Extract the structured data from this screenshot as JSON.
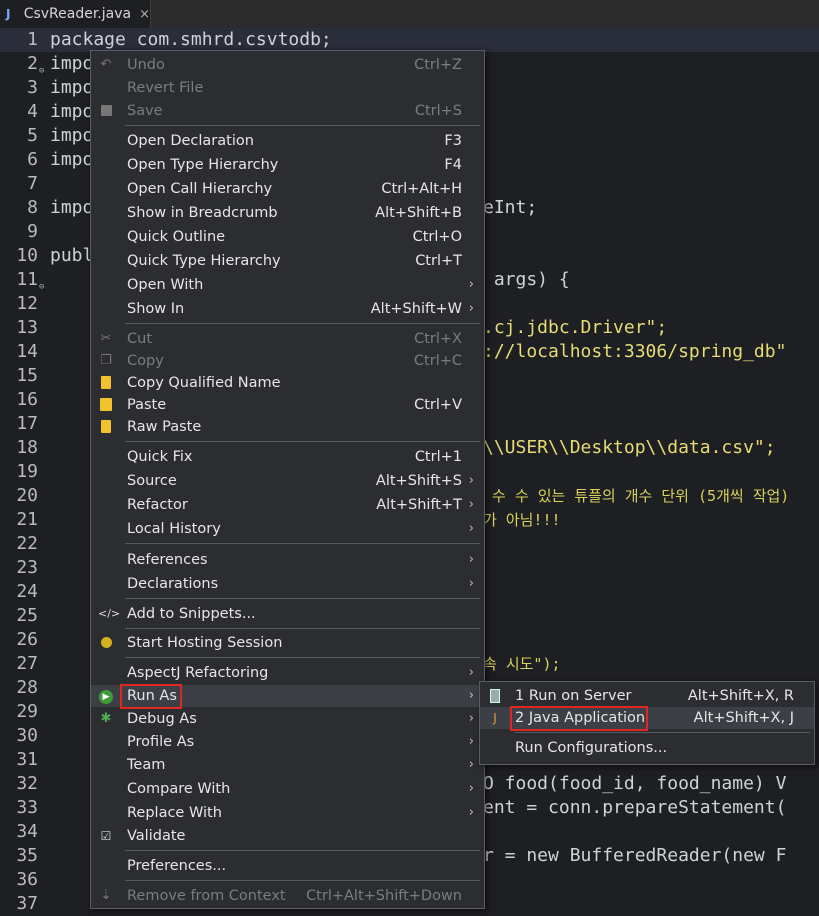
{
  "tab": {
    "label": "CsvReader.java",
    "close": "×",
    "icon": "J"
  },
  "editor": {
    "lines": [
      {
        "n": "1",
        "code": "package com.smhrd.csvtodb;"
      },
      {
        "n": "2",
        "code": "impo"
      },
      {
        "n": "3",
        "code": "impo"
      },
      {
        "n": "4",
        "code": "impo"
      },
      {
        "n": "5",
        "code": "impo"
      },
      {
        "n": "6",
        "code": "impo"
      },
      {
        "n": "7",
        "code": ""
      },
      {
        "n": "8",
        "code": "impo",
        "tail": "eInt;"
      },
      {
        "n": "9",
        "code": ""
      },
      {
        "n": "10",
        "code": "publ"
      },
      {
        "n": "11",
        "code": "",
        "tail": " args) {"
      },
      {
        "n": "12",
        "code": ""
      },
      {
        "n": "13",
        "code": "",
        "tail": ".cj.jdbc.Driver\";"
      },
      {
        "n": "14",
        "code": "",
        "tail": "://localhost:3306/spring_db\""
      },
      {
        "n": "15",
        "code": ""
      },
      {
        "n": "16",
        "code": ""
      },
      {
        "n": "17",
        "code": ""
      },
      {
        "n": "18",
        "code": "",
        "tail": "\\\\USER\\\\Desktop\\\\data.csv\";"
      },
      {
        "n": "19",
        "code": ""
      },
      {
        "n": "20",
        "code": "",
        "tail": " 수 수 있는 튜플의 개수 단위 (5개씩 작업)"
      },
      {
        "n": "21",
        "code": "",
        "tail": "가 아님!!!"
      },
      {
        "n": "22",
        "code": ""
      },
      {
        "n": "23",
        "code": ""
      },
      {
        "n": "24",
        "code": ""
      },
      {
        "n": "25",
        "code": ""
      },
      {
        "n": "26",
        "code": ""
      },
      {
        "n": "27",
        "code": "",
        "tail": "속 시도\");"
      },
      {
        "n": "28",
        "code": ""
      },
      {
        "n": "29",
        "code": ""
      },
      {
        "n": "30",
        "code": ""
      },
      {
        "n": "31",
        "code": ""
      },
      {
        "n": "32",
        "code": "",
        "tail": "O food(food_id, food_name) V"
      },
      {
        "n": "33",
        "code": "",
        "tail": "ent = conn.prepareStatement("
      },
      {
        "n": "34",
        "code": ""
      },
      {
        "n": "35",
        "code": "",
        "tail": "r = new BufferedReader(new F"
      },
      {
        "n": "36",
        "code": ""
      },
      {
        "n": "37",
        "code": ""
      }
    ]
  },
  "menu": {
    "undo": {
      "label": "Undo",
      "shortcut": "Ctrl+Z"
    },
    "revert": {
      "label": "Revert File"
    },
    "save": {
      "label": "Save",
      "shortcut": "Ctrl+S"
    },
    "open_declaration": {
      "label": "Open Declaration",
      "shortcut": "F3"
    },
    "open_type_hierarchy": {
      "label": "Open Type Hierarchy",
      "shortcut": "F4"
    },
    "open_call_hierarchy": {
      "label": "Open Call Hierarchy",
      "shortcut": "Ctrl+Alt+H"
    },
    "show_breadcrumb": {
      "label": "Show in Breadcrumb",
      "shortcut": "Alt+Shift+B"
    },
    "quick_outline": {
      "label": "Quick Outline",
      "shortcut": "Ctrl+O"
    },
    "quick_type_hierarchy": {
      "label": "Quick Type Hierarchy",
      "shortcut": "Ctrl+T"
    },
    "open_with": {
      "label": "Open With"
    },
    "show_in": {
      "label": "Show In",
      "shortcut": "Alt+Shift+W"
    },
    "cut": {
      "label": "Cut",
      "shortcut": "Ctrl+X"
    },
    "copy": {
      "label": "Copy",
      "shortcut": "Ctrl+C"
    },
    "copy_qualified": {
      "label": "Copy Qualified Name"
    },
    "paste": {
      "label": "Paste",
      "shortcut": "Ctrl+V"
    },
    "raw_paste": {
      "label": "Raw Paste"
    },
    "quick_fix": {
      "label": "Quick Fix",
      "shortcut": "Ctrl+1"
    },
    "source": {
      "label": "Source",
      "shortcut": "Alt+Shift+S"
    },
    "refactor": {
      "label": "Refactor",
      "shortcut": "Alt+Shift+T"
    },
    "local_history": {
      "label": "Local History"
    },
    "references": {
      "label": "References"
    },
    "declarations": {
      "label": "Declarations"
    },
    "add_snippets": {
      "label": "Add to Snippets..."
    },
    "start_hosting": {
      "label": "Start Hosting Session"
    },
    "aspectj": {
      "label": "AspectJ Refactoring"
    },
    "run_as": {
      "label": "Run As"
    },
    "debug_as": {
      "label": "Debug As"
    },
    "profile_as": {
      "label": "Profile As"
    },
    "team": {
      "label": "Team"
    },
    "compare_with": {
      "label": "Compare With"
    },
    "replace_with": {
      "label": "Replace With"
    },
    "validate": {
      "label": "Validate"
    },
    "preferences": {
      "label": "Preferences..."
    },
    "remove_context": {
      "label": "Remove from Context",
      "shortcut": "Ctrl+Alt+Shift+Down"
    }
  },
  "submenu": {
    "run_on_server": {
      "label": "1 Run on Server",
      "shortcut": "Alt+Shift+X, R"
    },
    "java_application": {
      "label": "2 Java Application",
      "shortcut": "Alt+Shift+X, J"
    },
    "run_configurations": {
      "label": "Run Configurations..."
    }
  },
  "colors": {
    "highlight_box": "#e0261f",
    "menu_bg": "#2b2d30",
    "editor_bg": "#1e1f22"
  }
}
